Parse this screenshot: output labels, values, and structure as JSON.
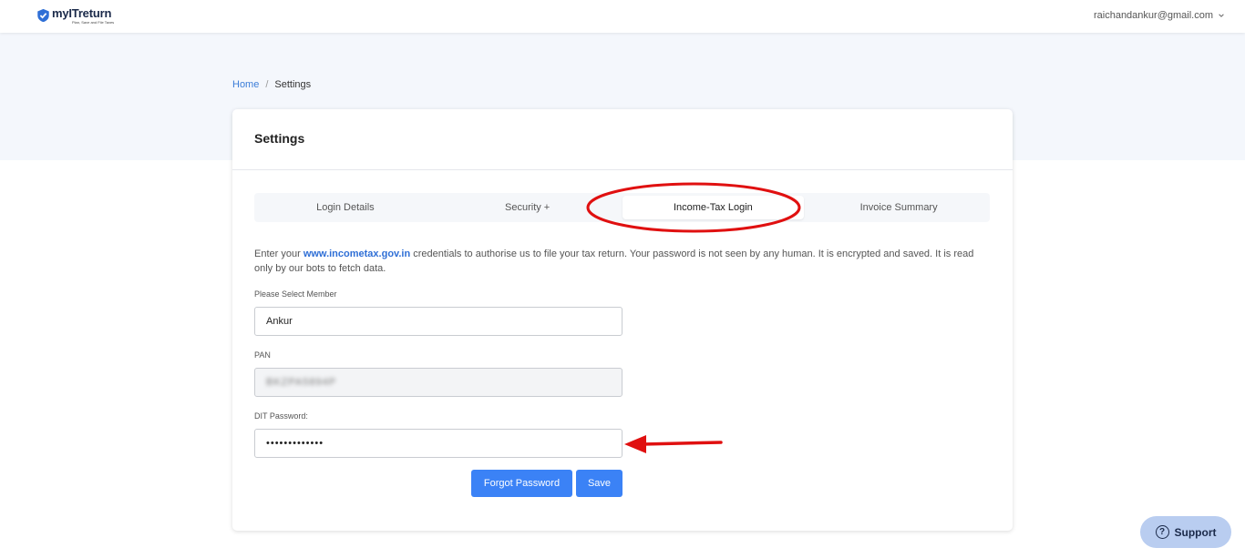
{
  "header": {
    "logo_name": "myITreturn",
    "logo_tagline": "Plan, Save and File Taxes",
    "user_email": "raichandankur@gmail.com"
  },
  "breadcrumb": {
    "home": "Home",
    "separator": "/",
    "current": "Settings"
  },
  "card": {
    "title": "Settings",
    "tabs": [
      {
        "label": "Login Details"
      },
      {
        "label": "Security +"
      },
      {
        "label": "Income-Tax Login"
      },
      {
        "label": "Invoice Summary"
      }
    ],
    "description_prefix": "Enter your ",
    "description_link": "www.incometax.gov.in",
    "description_suffix": " credentials to authorise us to file your tax return. Your password is not seen by any human. It is encrypted and saved. It is read only by our bots to fetch data.",
    "member_label": "Please Select Member",
    "member_value": "Ankur",
    "pan_label": "PAN",
    "pan_value": "BKZPA5894P",
    "password_label": "DIT Password:",
    "password_value": "•••••••••••••",
    "forgot_label": "Forgot Password",
    "save_label": "Save"
  },
  "support": {
    "label": "Support"
  },
  "colors": {
    "accent": "#3b82f6",
    "annotation": "#e01010"
  }
}
